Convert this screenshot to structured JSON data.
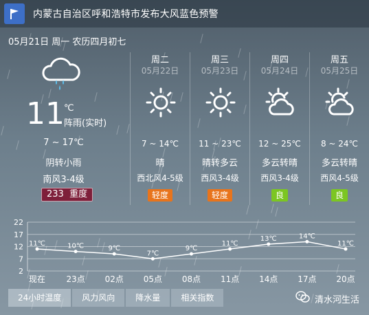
{
  "alert": {
    "text": "内蒙古自治区呼和浩特市发布大风蓝色预警",
    "icon": "flag-icon",
    "color": "#3d6fc7"
  },
  "date_line": "05月21日 周一 农历四月初七",
  "today": {
    "temp": "11",
    "unit": "℃",
    "condition_now": "阵雨(实时)",
    "range": "7 ~ 17℃",
    "desc": "阴转小雨",
    "wind": "南风3-4级",
    "aqi_value": "233",
    "aqi_label": "重度",
    "aqi_color": "#7e1f3a",
    "icon": "cloud-rain-icon"
  },
  "forecast": [
    {
      "day": "周二",
      "date": "05月22日",
      "icon": "sun-icon",
      "range": "7 ~ 14℃",
      "desc": "晴",
      "wind": "西北风4-5级",
      "aqi": "轻度",
      "aqi_color": "#e8741c"
    },
    {
      "day": "周三",
      "date": "05月23日",
      "icon": "sun-icon",
      "range": "11 ~ 23℃",
      "desc": "晴转多云",
      "wind": "西风3-4级",
      "aqi": "轻度",
      "aqi_color": "#e8741c"
    },
    {
      "day": "周四",
      "date": "05月24日",
      "icon": "partly-cloudy-icon",
      "range": "12 ~ 25℃",
      "desc": "多云转晴",
      "wind": "西风3-4级",
      "aqi": "良",
      "aqi_color": "#7cc622"
    },
    {
      "day": "周五",
      "date": "05月25日",
      "icon": "partly-cloudy-icon",
      "range": "8 ~ 24℃",
      "desc": "多云转晴",
      "wind": "西风4-5级",
      "aqi": "良",
      "aqi_color": "#7cc622"
    }
  ],
  "chart_data": {
    "type": "line",
    "categories": [
      "现在",
      "23点",
      "02点",
      "05点",
      "08点",
      "11点",
      "14点",
      "17点",
      "20点"
    ],
    "values": [
      11,
      10,
      9,
      7,
      9,
      11,
      13,
      14,
      11
    ],
    "point_labels": [
      "11℃",
      "10℃",
      "9℃",
      "7℃",
      "9℃",
      "11℃",
      "13℃",
      "14℃",
      "11℃"
    ],
    "yticks": [
      22,
      17,
      12,
      7,
      2
    ],
    "ylim": [
      2,
      22
    ],
    "grid": true
  },
  "tabs": [
    "24小时温度",
    "风力风向",
    "降水量",
    "相关指数"
  ],
  "watermark": {
    "text": "清水河生活",
    "icon": "wechat-icon"
  }
}
